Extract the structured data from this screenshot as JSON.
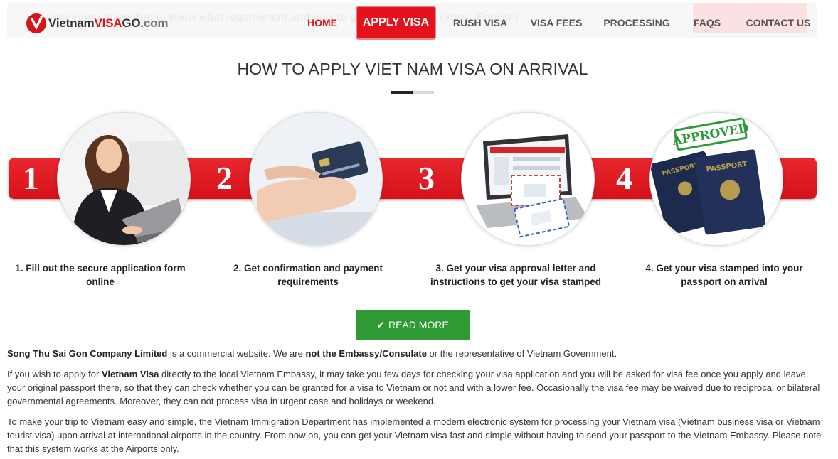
{
  "header": {
    "ghost_text": "Select your citizenship to know what requirement and how to get Vietnam visa. (Sorry, English)",
    "logo": {
      "part1": "Vietnam",
      "part2": "VISA",
      "part3": "GO",
      "part4": ".com"
    },
    "nav": {
      "home": "HOME",
      "apply": "APPLY VISA",
      "rush": "RUSH VISA",
      "fees": "VISA FEES",
      "processing": "PROCESSING",
      "faqs": "FAQS",
      "contact": "CONTACT US"
    }
  },
  "section": {
    "title": "HOW TO APPLY VIET NAM VISA ON ARRIVAL"
  },
  "steps": [
    {
      "number": "1",
      "label": "1. Fill out the secure application form online"
    },
    {
      "number": "2",
      "label": "2. Get confirmation and payment requirements"
    },
    {
      "number": "3",
      "label": "3. Get your visa approval letter and instructions to get your visa stamped"
    },
    {
      "number": "4",
      "label": "4. Get your visa stamped into your passport on arrival"
    }
  ],
  "images": {
    "approved_stamp": "APPROVED",
    "passport": "PASSPORT"
  },
  "read_more": "READ MORE",
  "paragraphs": {
    "p1": {
      "company": "Song Thu Sai Gon Company Limited",
      "t1": " is a commercial website. We are ",
      "bold2": "not the Embassy/Consulate",
      "t2": " or the representative of Vietnam Government."
    },
    "p2": {
      "t1": "If you wish to apply for ",
      "bold": "Vietnam Visa",
      "t2": " directly to the local Vietnam Embassy, it may take you few days for checking your visa application and you will be asked for visa fee once you apply and leave your original passport there, so that they can check whether you can be granted for a visa to Vietnam or not and with a lower fee. Occasionally the visa fee may be waived due to reciprocal or bilateral governmental agreements. Moreover, they can not process visa in urgent case and holidays or weekend."
    },
    "p3": {
      "text": "To make your trip to Vietnam easy and simple, the Vietnam Immigration Department has implemented a modern electronic system for processing your Vietnam visa (Vietnam business visa or Vietnam tourist visa) upon arrival at international airports in the country. From now on, you can get your Vietnam visa fast and simple without having to send your passport to the Vietnam Embassy. Please note that this system works at the Airports only."
    }
  },
  "colors": {
    "brand_red": "#e3121c",
    "read_more_green": "#2f9a33"
  }
}
